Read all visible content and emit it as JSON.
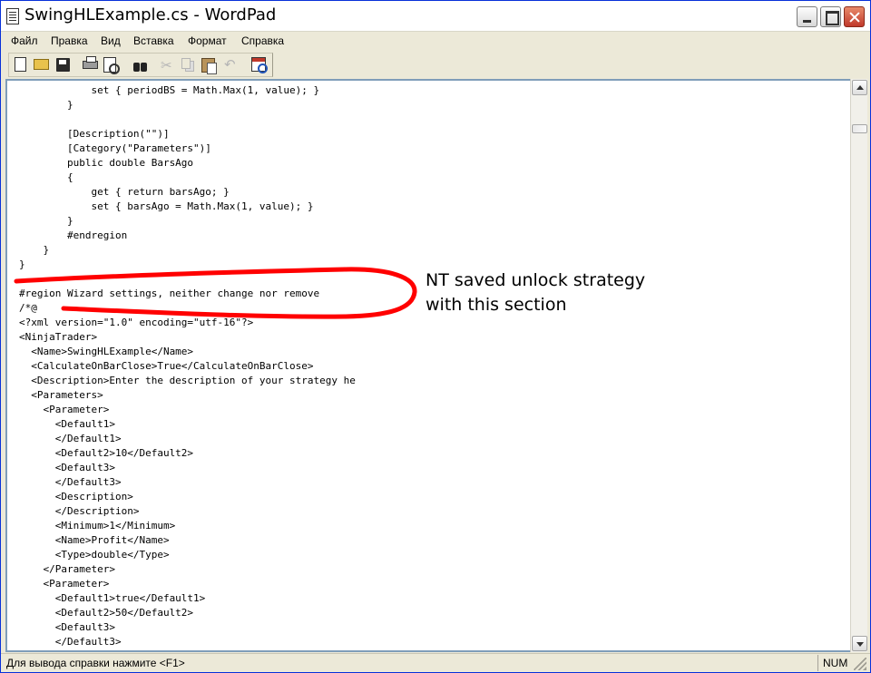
{
  "window": {
    "title": "SwingHLExample.cs - WordPad"
  },
  "menu": [
    "Файл",
    "Правка",
    "Вид",
    "Вставка",
    "Формат",
    "Справка"
  ],
  "toolbar": {
    "icons": [
      "new-document-icon",
      "open-folder-icon",
      "save-icon",
      "print-icon",
      "print-preview-icon",
      "find-icon",
      "cut-icon",
      "copy-icon",
      "paste-icon",
      "undo-icon",
      "insert-date-time-icon"
    ]
  },
  "editor": {
    "lines": [
      "            set { periodBS = Math.Max(1, value); }",
      "        }",
      "",
      "        [Description(\"\")]",
      "        [Category(\"Parameters\")]",
      "        public double BarsAgo",
      "        {",
      "            get { return barsAgo; }",
      "            set { barsAgo = Math.Max(1, value); }",
      "        }",
      "        #endregion",
      "    }",
      "}",
      "",
      "#region Wizard settings, neither change nor remove",
      "/*@",
      "<?xml version=\"1.0\" encoding=\"utf-16\"?>",
      "<NinjaTrader>",
      "  <Name>SwingHLExample</Name>",
      "  <CalculateOnBarClose>True</CalculateOnBarClose>",
      "  <Description>Enter the description of your strategy he",
      "  <Parameters>",
      "    <Parameter>",
      "      <Default1>",
      "      </Default1>",
      "      <Default2>10</Default2>",
      "      <Default3>",
      "      </Default3>",
      "      <Description>",
      "      </Description>",
      "      <Minimum>1</Minimum>",
      "      <Name>Profit</Name>",
      "      <Type>double</Type>",
      "    </Parameter>",
      "    <Parameter>",
      "      <Default1>true</Default1>",
      "      <Default2>50</Default2>",
      "      <Default3>",
      "      </Default3>"
    ]
  },
  "annotation": {
    "line1": "NT saved unlock strategy",
    "line2": "with this section",
    "color": "#ff0000"
  },
  "status": {
    "help_text": "Для вывода справки нажмите <F1>",
    "num_indicator": "NUM"
  }
}
